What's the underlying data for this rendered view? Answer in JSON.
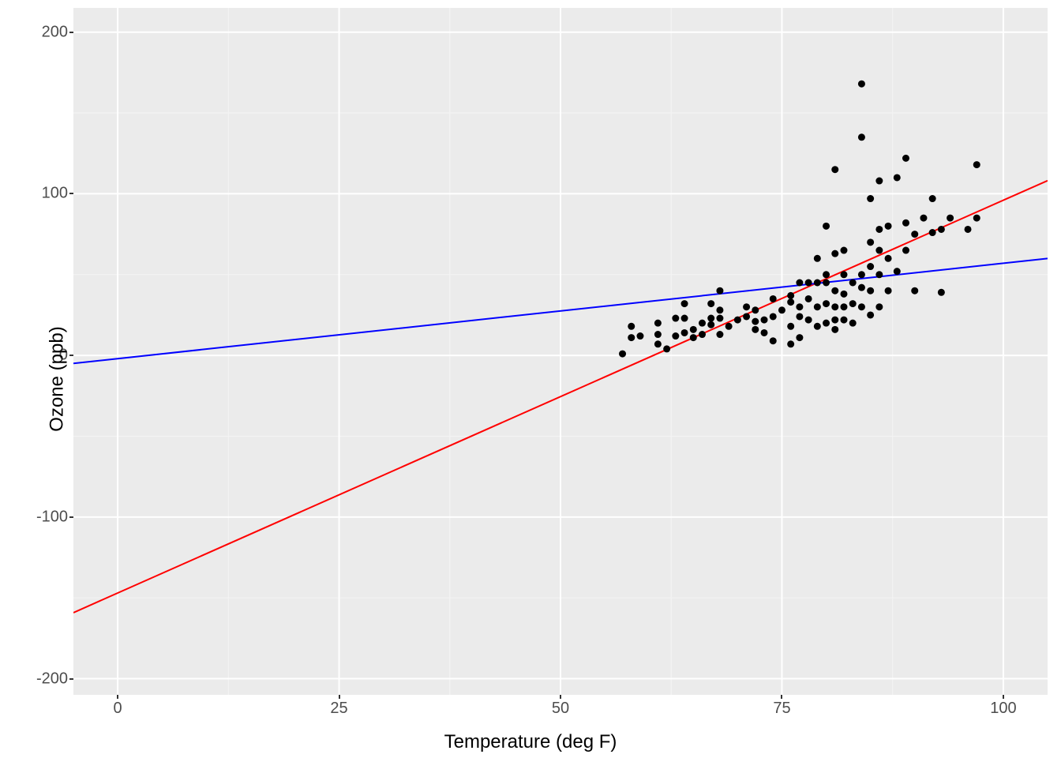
{
  "chart_data": {
    "type": "scatter",
    "xlabel": "Temperature (deg F)",
    "ylabel": "Ozone (ppb)",
    "xlim": [
      -5,
      105
    ],
    "ylim": [
      -210,
      215
    ],
    "x_ticks": [
      0,
      25,
      50,
      75,
      100
    ],
    "y_ticks": [
      -200,
      -100,
      0,
      100,
      200
    ],
    "x_minor": [
      12.5,
      37.5,
      62.5,
      87.5
    ],
    "y_minor": [
      -150,
      -50,
      50,
      150
    ],
    "panel_bg": "#ebebeb",
    "grid_major": "#ffffff",
    "grid_minor": "#f4f4f4",
    "series": [
      {
        "name": "points",
        "kind": "scatter",
        "color": "#000000",
        "data": [
          [
            57,
            1
          ],
          [
            58,
            11
          ],
          [
            58,
            18
          ],
          [
            59,
            12
          ],
          [
            61,
            7
          ],
          [
            61,
            20
          ],
          [
            61,
            13
          ],
          [
            62,
            4
          ],
          [
            63,
            12
          ],
          [
            63,
            23
          ],
          [
            64,
            14
          ],
          [
            64,
            23
          ],
          [
            64,
            32
          ],
          [
            65,
            16
          ],
          [
            65,
            11
          ],
          [
            66,
            13
          ],
          [
            66,
            20
          ],
          [
            67,
            19
          ],
          [
            67,
            23
          ],
          [
            67,
            32
          ],
          [
            68,
            13
          ],
          [
            68,
            23
          ],
          [
            68,
            28
          ],
          [
            68,
            40
          ],
          [
            69,
            18
          ],
          [
            70,
            22
          ],
          [
            71,
            24
          ],
          [
            71,
            30
          ],
          [
            72,
            16
          ],
          [
            72,
            21
          ],
          [
            72,
            28
          ],
          [
            73,
            14
          ],
          [
            73,
            22
          ],
          [
            74,
            9
          ],
          [
            74,
            24
          ],
          [
            74,
            35
          ],
          [
            75,
            28
          ],
          [
            76,
            7
          ],
          [
            76,
            18
          ],
          [
            76,
            33
          ],
          [
            76,
            37
          ],
          [
            77,
            11
          ],
          [
            77,
            24
          ],
          [
            77,
            30
          ],
          [
            77,
            45
          ],
          [
            78,
            22
          ],
          [
            78,
            35
          ],
          [
            78,
            45
          ],
          [
            79,
            18
          ],
          [
            79,
            30
          ],
          [
            79,
            45
          ],
          [
            79,
            60
          ],
          [
            80,
            20
          ],
          [
            80,
            32
          ],
          [
            80,
            45
          ],
          [
            80,
            50
          ],
          [
            80,
            80
          ],
          [
            81,
            16
          ],
          [
            81,
            22
          ],
          [
            81,
            30
          ],
          [
            81,
            40
          ],
          [
            81,
            63
          ],
          [
            81,
            115
          ],
          [
            82,
            22
          ],
          [
            82,
            30
          ],
          [
            82,
            38
          ],
          [
            82,
            50
          ],
          [
            82,
            65
          ],
          [
            83,
            20
          ],
          [
            83,
            32
          ],
          [
            83,
            45
          ],
          [
            84,
            30
          ],
          [
            84,
            42
          ],
          [
            84,
            50
          ],
          [
            84,
            135
          ],
          [
            84,
            168
          ],
          [
            85,
            25
          ],
          [
            85,
            40
          ],
          [
            85,
            55
          ],
          [
            85,
            70
          ],
          [
            85,
            97
          ],
          [
            86,
            30
          ],
          [
            86,
            50
          ],
          [
            86,
            65
          ],
          [
            86,
            78
          ],
          [
            86,
            108
          ],
          [
            87,
            40
          ],
          [
            87,
            60
          ],
          [
            87,
            80
          ],
          [
            88,
            52
          ],
          [
            88,
            110
          ],
          [
            89,
            65
          ],
          [
            89,
            82
          ],
          [
            89,
            122
          ],
          [
            90,
            40
          ],
          [
            90,
            75
          ],
          [
            91,
            85
          ],
          [
            92,
            76
          ],
          [
            92,
            97
          ],
          [
            93,
            78
          ],
          [
            93,
            39
          ],
          [
            94,
            85
          ],
          [
            96,
            78
          ],
          [
            97,
            85
          ],
          [
            97,
            118
          ]
        ]
      },
      {
        "name": "line_red",
        "kind": "line",
        "color": "#ff0000",
        "intercept": -147,
        "slope": 2.43
      },
      {
        "name": "line_blue",
        "kind": "line",
        "color": "#0000ff",
        "intercept": -2,
        "slope": 0.59
      }
    ]
  }
}
